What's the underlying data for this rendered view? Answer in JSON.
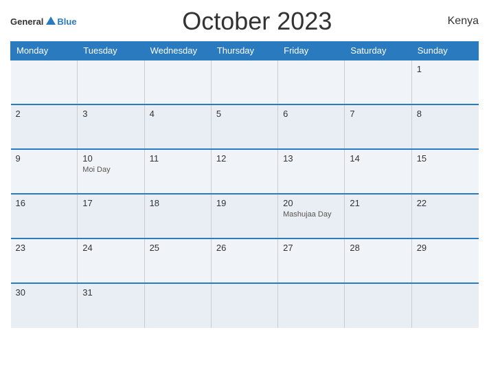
{
  "header": {
    "logo": {
      "general": "General",
      "blue": "Blue",
      "triangle": true
    },
    "title": "October 2023",
    "country": "Kenya"
  },
  "calendar": {
    "weekdays": [
      "Monday",
      "Tuesday",
      "Wednesday",
      "Thursday",
      "Friday",
      "Saturday",
      "Sunday"
    ],
    "weeks": [
      [
        {
          "day": "",
          "holiday": ""
        },
        {
          "day": "",
          "holiday": ""
        },
        {
          "day": "",
          "holiday": ""
        },
        {
          "day": "",
          "holiday": ""
        },
        {
          "day": "",
          "holiday": ""
        },
        {
          "day": "",
          "holiday": ""
        },
        {
          "day": "1",
          "holiday": ""
        }
      ],
      [
        {
          "day": "2",
          "holiday": ""
        },
        {
          "day": "3",
          "holiday": ""
        },
        {
          "day": "4",
          "holiday": ""
        },
        {
          "day": "5",
          "holiday": ""
        },
        {
          "day": "6",
          "holiday": ""
        },
        {
          "day": "7",
          "holiday": ""
        },
        {
          "day": "8",
          "holiday": ""
        }
      ],
      [
        {
          "day": "9",
          "holiday": ""
        },
        {
          "day": "10",
          "holiday": "Moi Day"
        },
        {
          "day": "11",
          "holiday": ""
        },
        {
          "day": "12",
          "holiday": ""
        },
        {
          "day": "13",
          "holiday": ""
        },
        {
          "day": "14",
          "holiday": ""
        },
        {
          "day": "15",
          "holiday": ""
        }
      ],
      [
        {
          "day": "16",
          "holiday": ""
        },
        {
          "day": "17",
          "holiday": ""
        },
        {
          "day": "18",
          "holiday": ""
        },
        {
          "day": "19",
          "holiday": ""
        },
        {
          "day": "20",
          "holiday": "Mashujaa Day"
        },
        {
          "day": "21",
          "holiday": ""
        },
        {
          "day": "22",
          "holiday": ""
        }
      ],
      [
        {
          "day": "23",
          "holiday": ""
        },
        {
          "day": "24",
          "holiday": ""
        },
        {
          "day": "25",
          "holiday": ""
        },
        {
          "day": "26",
          "holiday": ""
        },
        {
          "day": "27",
          "holiday": ""
        },
        {
          "day": "28",
          "holiday": ""
        },
        {
          "day": "29",
          "holiday": ""
        }
      ],
      [
        {
          "day": "30",
          "holiday": ""
        },
        {
          "day": "31",
          "holiday": ""
        },
        {
          "day": "",
          "holiday": ""
        },
        {
          "day": "",
          "holiday": ""
        },
        {
          "day": "",
          "holiday": ""
        },
        {
          "day": "",
          "holiday": ""
        },
        {
          "day": "",
          "holiday": ""
        }
      ]
    ]
  }
}
